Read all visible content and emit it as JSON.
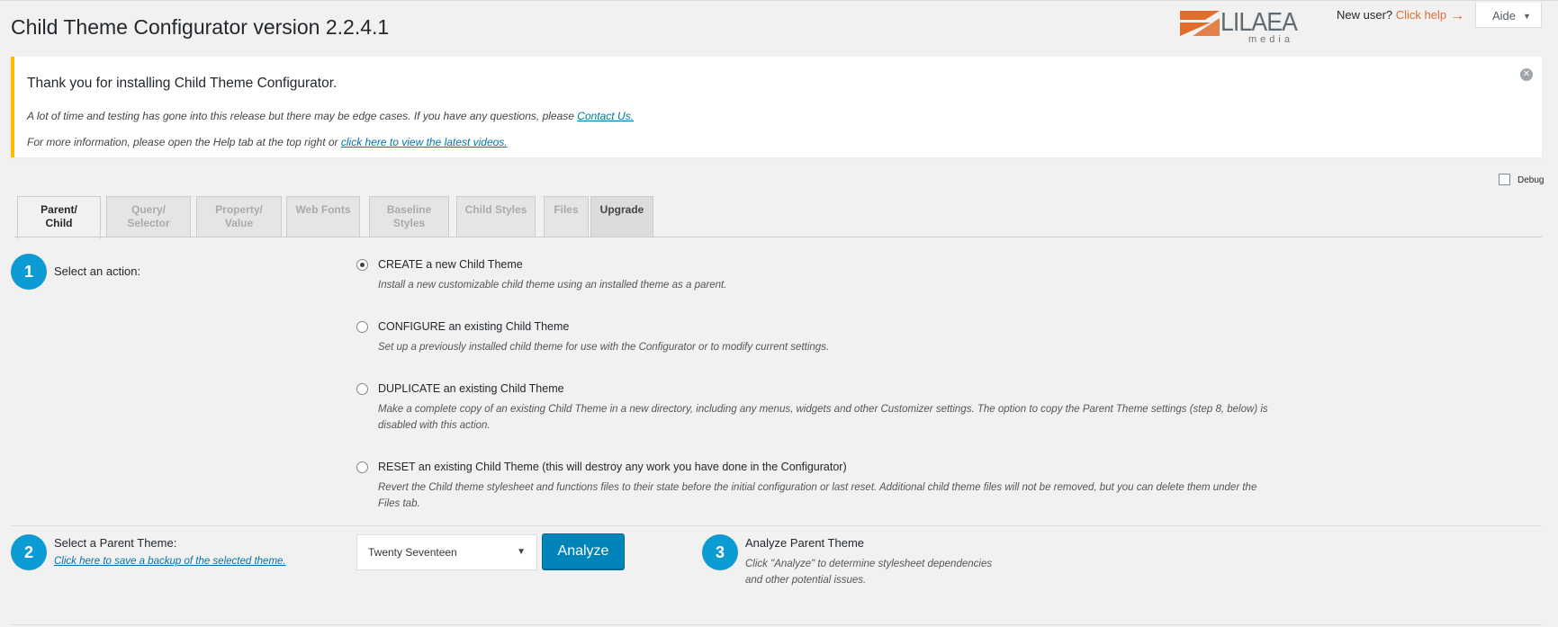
{
  "header": {
    "title": "Child Theme Configurator version 2.2.4.1",
    "logo_word": "LILAEA",
    "logo_sub": "media",
    "new_user_text": "New user?",
    "click_help": "Click help",
    "aide_label": "Aide",
    "accent_color": "#e06d2d"
  },
  "notice": {
    "title": "Thank you for installing Child Theme Configurator.",
    "line1_text": "A lot of time and testing has gone into this release but there may be edge cases. If you have any questions, please ",
    "line1_link": "Contact Us.",
    "line2_text": "For more information, please open the Help tab at the top right or ",
    "line2_link": "click here to view the latest videos.",
    "border_color": "#ffb900"
  },
  "debug_label": "Debug",
  "tabs": [
    {
      "line1": "Parent/",
      "line2": "Child"
    },
    {
      "line1": "Query/",
      "line2": "Selector"
    },
    {
      "line1": "Property/",
      "line2": "Value"
    },
    {
      "line1": "Web Fonts",
      "line2": ""
    },
    {
      "line1": "Baseline",
      "line2": "Styles"
    },
    {
      "line1": "Child Styles",
      "line2": ""
    },
    {
      "line1": "Files",
      "line2": ""
    },
    {
      "line1": "Upgrade",
      "line2": ""
    }
  ],
  "steps": {
    "one": {
      "num": "1",
      "label": "Select an action:"
    },
    "two": {
      "num": "2",
      "label": "Select a Parent Theme:",
      "link": "Click here to save a backup of the selected theme."
    },
    "three": {
      "num": "3",
      "label": "Analyze Parent Theme",
      "desc_line1": "Click \"Analyze\" to determine stylesheet dependencies",
      "desc_line2": "and other potential issues."
    }
  },
  "actions": [
    {
      "title": "CREATE a new Child Theme",
      "desc": "Install a new customizable child theme using an installed theme as a parent.",
      "checked": true
    },
    {
      "title": "CONFIGURE an existing Child Theme",
      "desc": "Set up a previously installed child theme for use with the Configurator or to modify current settings.",
      "checked": false
    },
    {
      "title": "DUPLICATE an existing Child Theme",
      "desc": "Make a complete copy of an existing Child Theme in a new directory, including any menus, widgets and other Customizer settings. The option to copy the Parent Theme settings (step 8, below) is disabled with this action.",
      "checked": false
    },
    {
      "title": "RESET an existing Child Theme (this will destroy any work you have done in the Configurator)",
      "desc": "Revert the Child theme stylesheet and functions files to their state before the initial configuration or last reset. Additional child theme files will not be removed, but you can delete them under the Files tab.",
      "checked": false
    }
  ],
  "parent_select": {
    "value": "Twenty Seventeen"
  },
  "analyze_button": "Analyze",
  "step_color": "#0c9bd3",
  "button_color": "#0085ba"
}
